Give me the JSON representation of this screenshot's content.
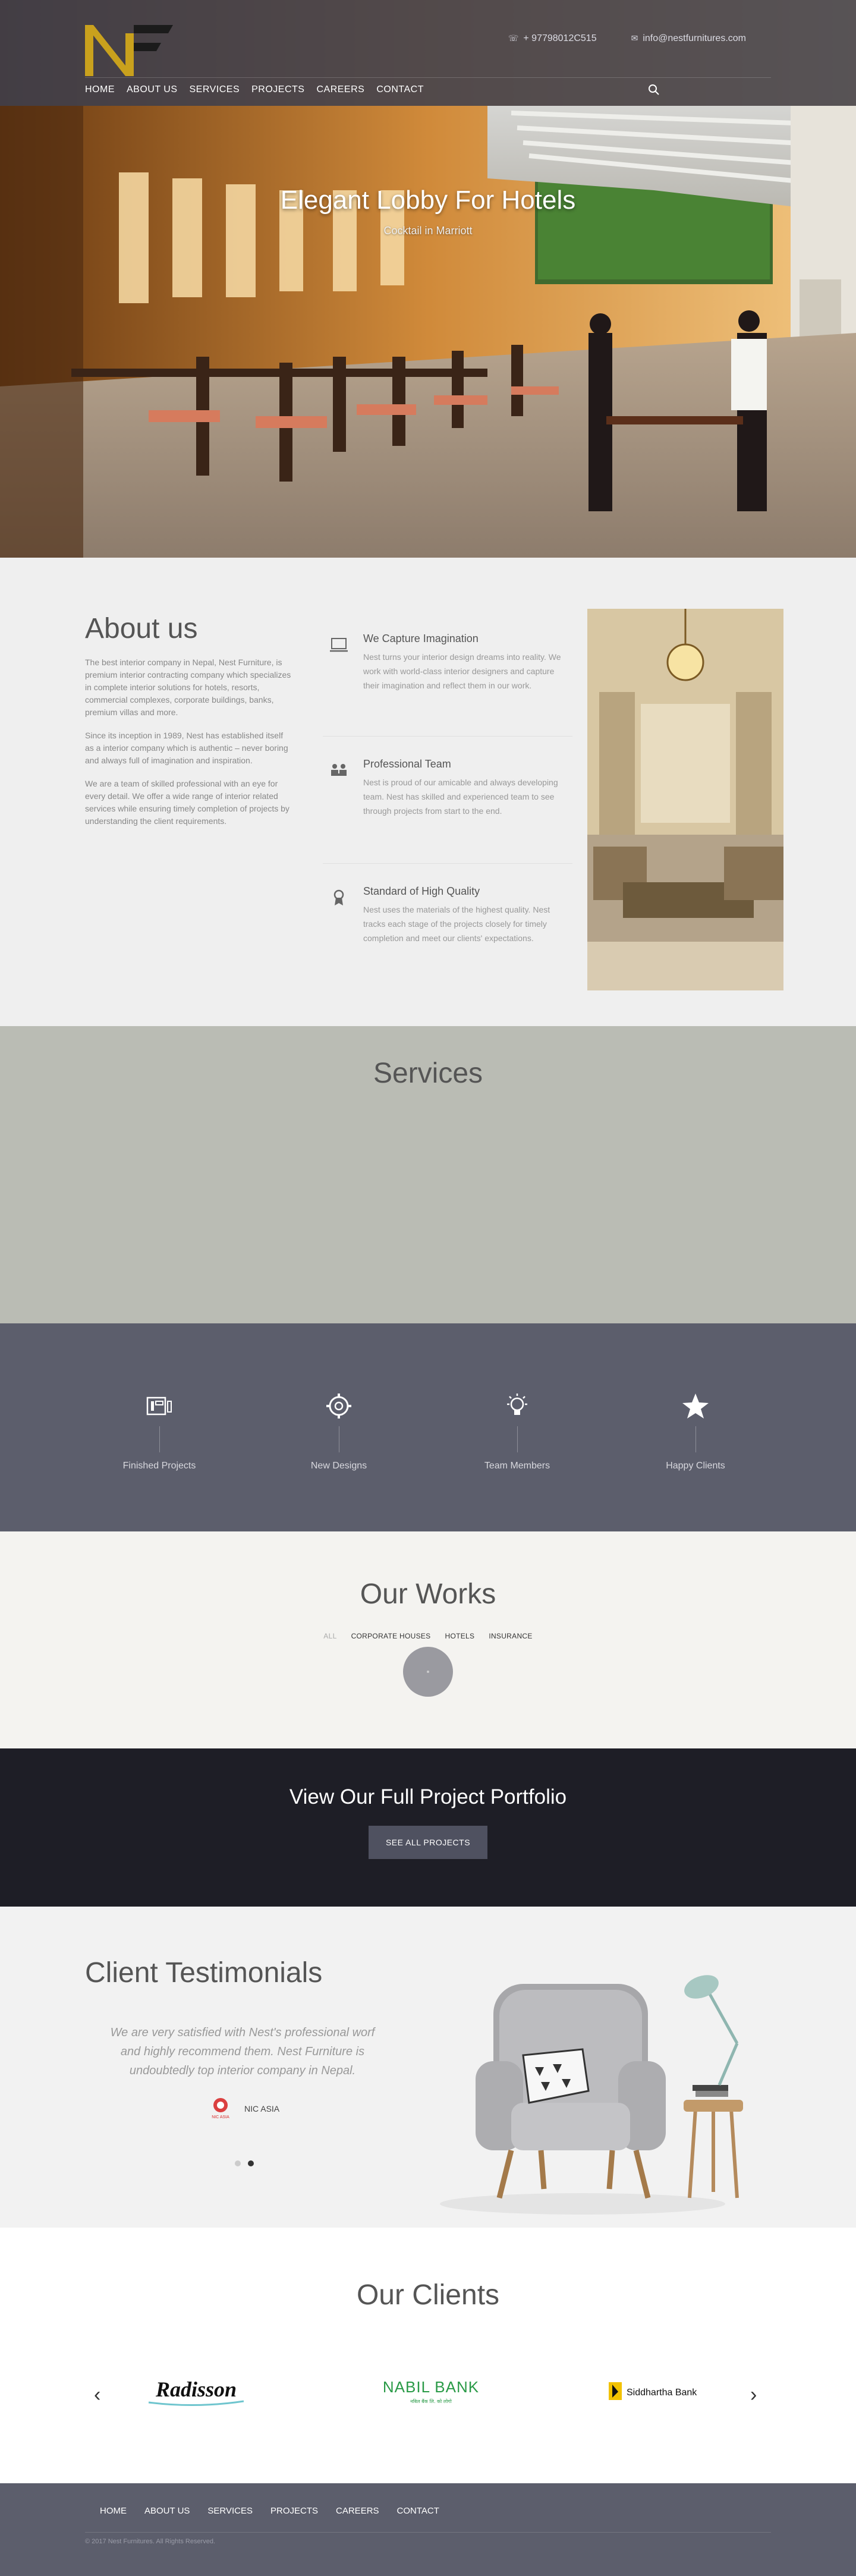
{
  "header": {
    "phone": "+ 97798012C515",
    "email": "info@nestfurnitures.com",
    "nav": [
      "Home",
      "About Us",
      "Services",
      "Projects",
      "Careers",
      "Contact"
    ]
  },
  "hero": {
    "title": "Elegant Lobby For Hotels",
    "subtitle": "Cocktail in Marriott"
  },
  "about": {
    "title": "About us",
    "paragraphs": [
      "The best interior company in Nepal, Nest Furniture, is premium interior contracting company which specializes in complete interior solutions for hotels, resorts, commercial complexes, corporate buildings, banks, premium villas and more.",
      "Since its inception in 1989, Nest  has established itself as a interior company which is authentic – never boring and always full of imagination and inspiration.",
      "We are a team of skilled professional with an eye for every detail. We offer a wide range of interior related services while ensuring timely completion of projects by understanding the client requirements."
    ],
    "features": [
      {
        "icon": "laptop-icon",
        "title": "We Capture Imagination",
        "text": "Nest turns your interior design dreams into reality. We work with world-class interior designers and capture their imagination and reflect them in our work."
      },
      {
        "icon": "team-icon",
        "title": "Professional Team",
        "text": "Nest is proud of our amicable and always developing team. Nest has skilled and experienced team to see through projects from start to the end."
      },
      {
        "icon": "medal-icon",
        "title": "Standard of High Quality",
        "text": "Nest uses the materials of the highest quality. Nest tracks each stage of the projects closely for timely completion and meet our clients' expectations."
      }
    ]
  },
  "services": {
    "title": "Services"
  },
  "stats": [
    {
      "icon": "projects-icon",
      "label": "Finished Projects"
    },
    {
      "icon": "gear-icon",
      "label": "New Designs"
    },
    {
      "icon": "lightbulb-icon",
      "label": "Team Members"
    },
    {
      "icon": "star-icon",
      "label": "Happy Clients"
    }
  ],
  "works": {
    "title": "Our Works",
    "filters": [
      "All",
      "Corporate Houses",
      "Hotels",
      "Insurance"
    ]
  },
  "cta": {
    "title": "View Our Full Project Portfolio",
    "button": "See All Projects"
  },
  "testimonials": {
    "title": "Client Testimonials",
    "quote": "We are very satisfied with Nest's professional worf and highly recommend them. Nest Furniture is undoubtedly top interior company in Nepal.",
    "client": "NIC ASIA",
    "client_logo_text": "NIC ASIA"
  },
  "clients": {
    "title": "Our Clients",
    "logos": [
      "Radisson",
      "NABIL BANK",
      "Siddhartha Bank"
    ],
    "logo_subtext": {
      "nabil": "नबिल बैंक लि. को लोगो"
    }
  },
  "footer": {
    "nav": [
      "Home",
      "About Us",
      "Services",
      "Projects",
      "Careers",
      "Contact"
    ],
    "copyright": "© 2017 Nest Furnitures. All Rights Reserved."
  },
  "colors": {
    "logo_gold": "#c9a11d",
    "header_bg": "#3c3e4e",
    "stats_bg": "#5c5e6c",
    "services_bg": "#babcb4",
    "cta_bg": "#1e1e26"
  }
}
